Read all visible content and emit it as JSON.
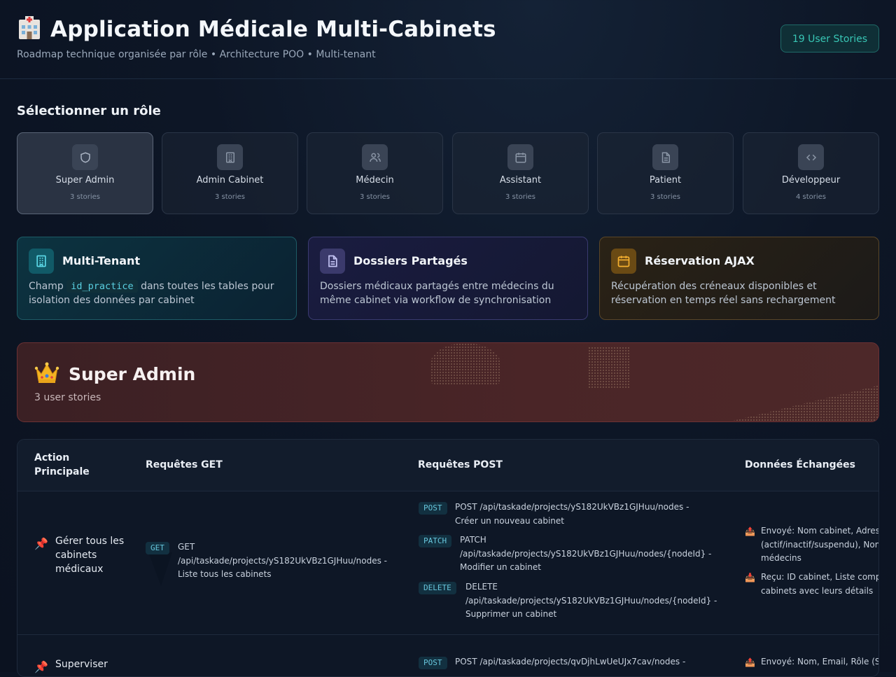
{
  "header": {
    "title": "Application Médicale Multi-Cabinets",
    "subtitle": "Roadmap technique organisée par rôle • Architecture POO • Multi-tenant",
    "badge": "19 User Stories"
  },
  "roles_section": {
    "title": "Sélectionner un rôle",
    "roles": [
      {
        "name": "Super Admin",
        "stories": "3 stories",
        "icon": "shield-icon",
        "active": true
      },
      {
        "name": "Admin Cabinet",
        "stories": "3 stories",
        "icon": "building-icon",
        "active": false
      },
      {
        "name": "Médecin",
        "stories": "3 stories",
        "icon": "users-icon",
        "active": false
      },
      {
        "name": "Assistant",
        "stories": "3 stories",
        "icon": "calendar-icon",
        "active": false
      },
      {
        "name": "Patient",
        "stories": "3 stories",
        "icon": "document-icon",
        "active": false
      },
      {
        "name": "Développeur",
        "stories": "4 stories",
        "icon": "code-icon",
        "active": false
      }
    ]
  },
  "features": [
    {
      "title": "Multi-Tenant",
      "desc_before": "Champ",
      "code": "id_practice",
      "desc_after": "dans toutes les tables pour isolation des données par cabinet",
      "icon": "building-icon",
      "color": "#38c6d5"
    },
    {
      "title": "Dossiers Partagés",
      "desc": "Dossiers médicaux partagés entre médecins du même cabinet via workflow de synchronisation",
      "icon": "document-icon",
      "color": "#a8a8e8"
    },
    {
      "title": "Réservation AJAX",
      "desc": "Récupération des créneaux disponibles et réservation en temps réel sans rechargement",
      "icon": "calendar-icon",
      "color": "#f0a020"
    }
  ],
  "role_banner": {
    "title": "Super Admin",
    "count": "3 user stories",
    "icon": "crown-icon"
  },
  "table": {
    "headers": {
      "action": "Action Principale",
      "get": "Requêtes GET",
      "post": "Requêtes POST",
      "data": "Données Échangées"
    },
    "rows": [
      {
        "action": "Gérer tous les cabinets médicaux",
        "get": [
          {
            "method": "GET",
            "text": "GET /api/taskade/projects/yS182UkVBz1GJHuu/nodes - Liste tous les cabinets"
          }
        ],
        "post": [
          {
            "method": "POST",
            "text": "POST /api/taskade/projects/yS182UkVBz1GJHuu/nodes - Créer un nouveau cabinet"
          },
          {
            "method": "PATCH",
            "text": "PATCH /api/taskade/projects/yS182UkVBz1GJHuu/nodes/{nodeId} - Modifier un cabinet"
          },
          {
            "method": "DELETE",
            "text": "DELETE /api/taskade/projects/yS182UkVBz1GJHuu/nodes/{nodeId} - Supprimer un cabinet"
          }
        ],
        "data": [
          {
            "line1": "Envoyé: Nom cabinet, Adres",
            "line2": "(actif/inactif/suspendu), Non",
            "line3": "médecins"
          },
          {
            "line1": "Reçu: ID cabinet, Liste comp",
            "line2": "cabinets avec leurs détails"
          }
        ]
      },
      {
        "action": "Superviser",
        "post": [
          {
            "method": "POST",
            "text": "POST /api/taskade/projects/qvDjhLwUeUJx7cav/nodes -"
          }
        ],
        "data": [
          {
            "line1": "Envoyé: Nom, Email, Rôle (S"
          }
        ]
      }
    ]
  }
}
